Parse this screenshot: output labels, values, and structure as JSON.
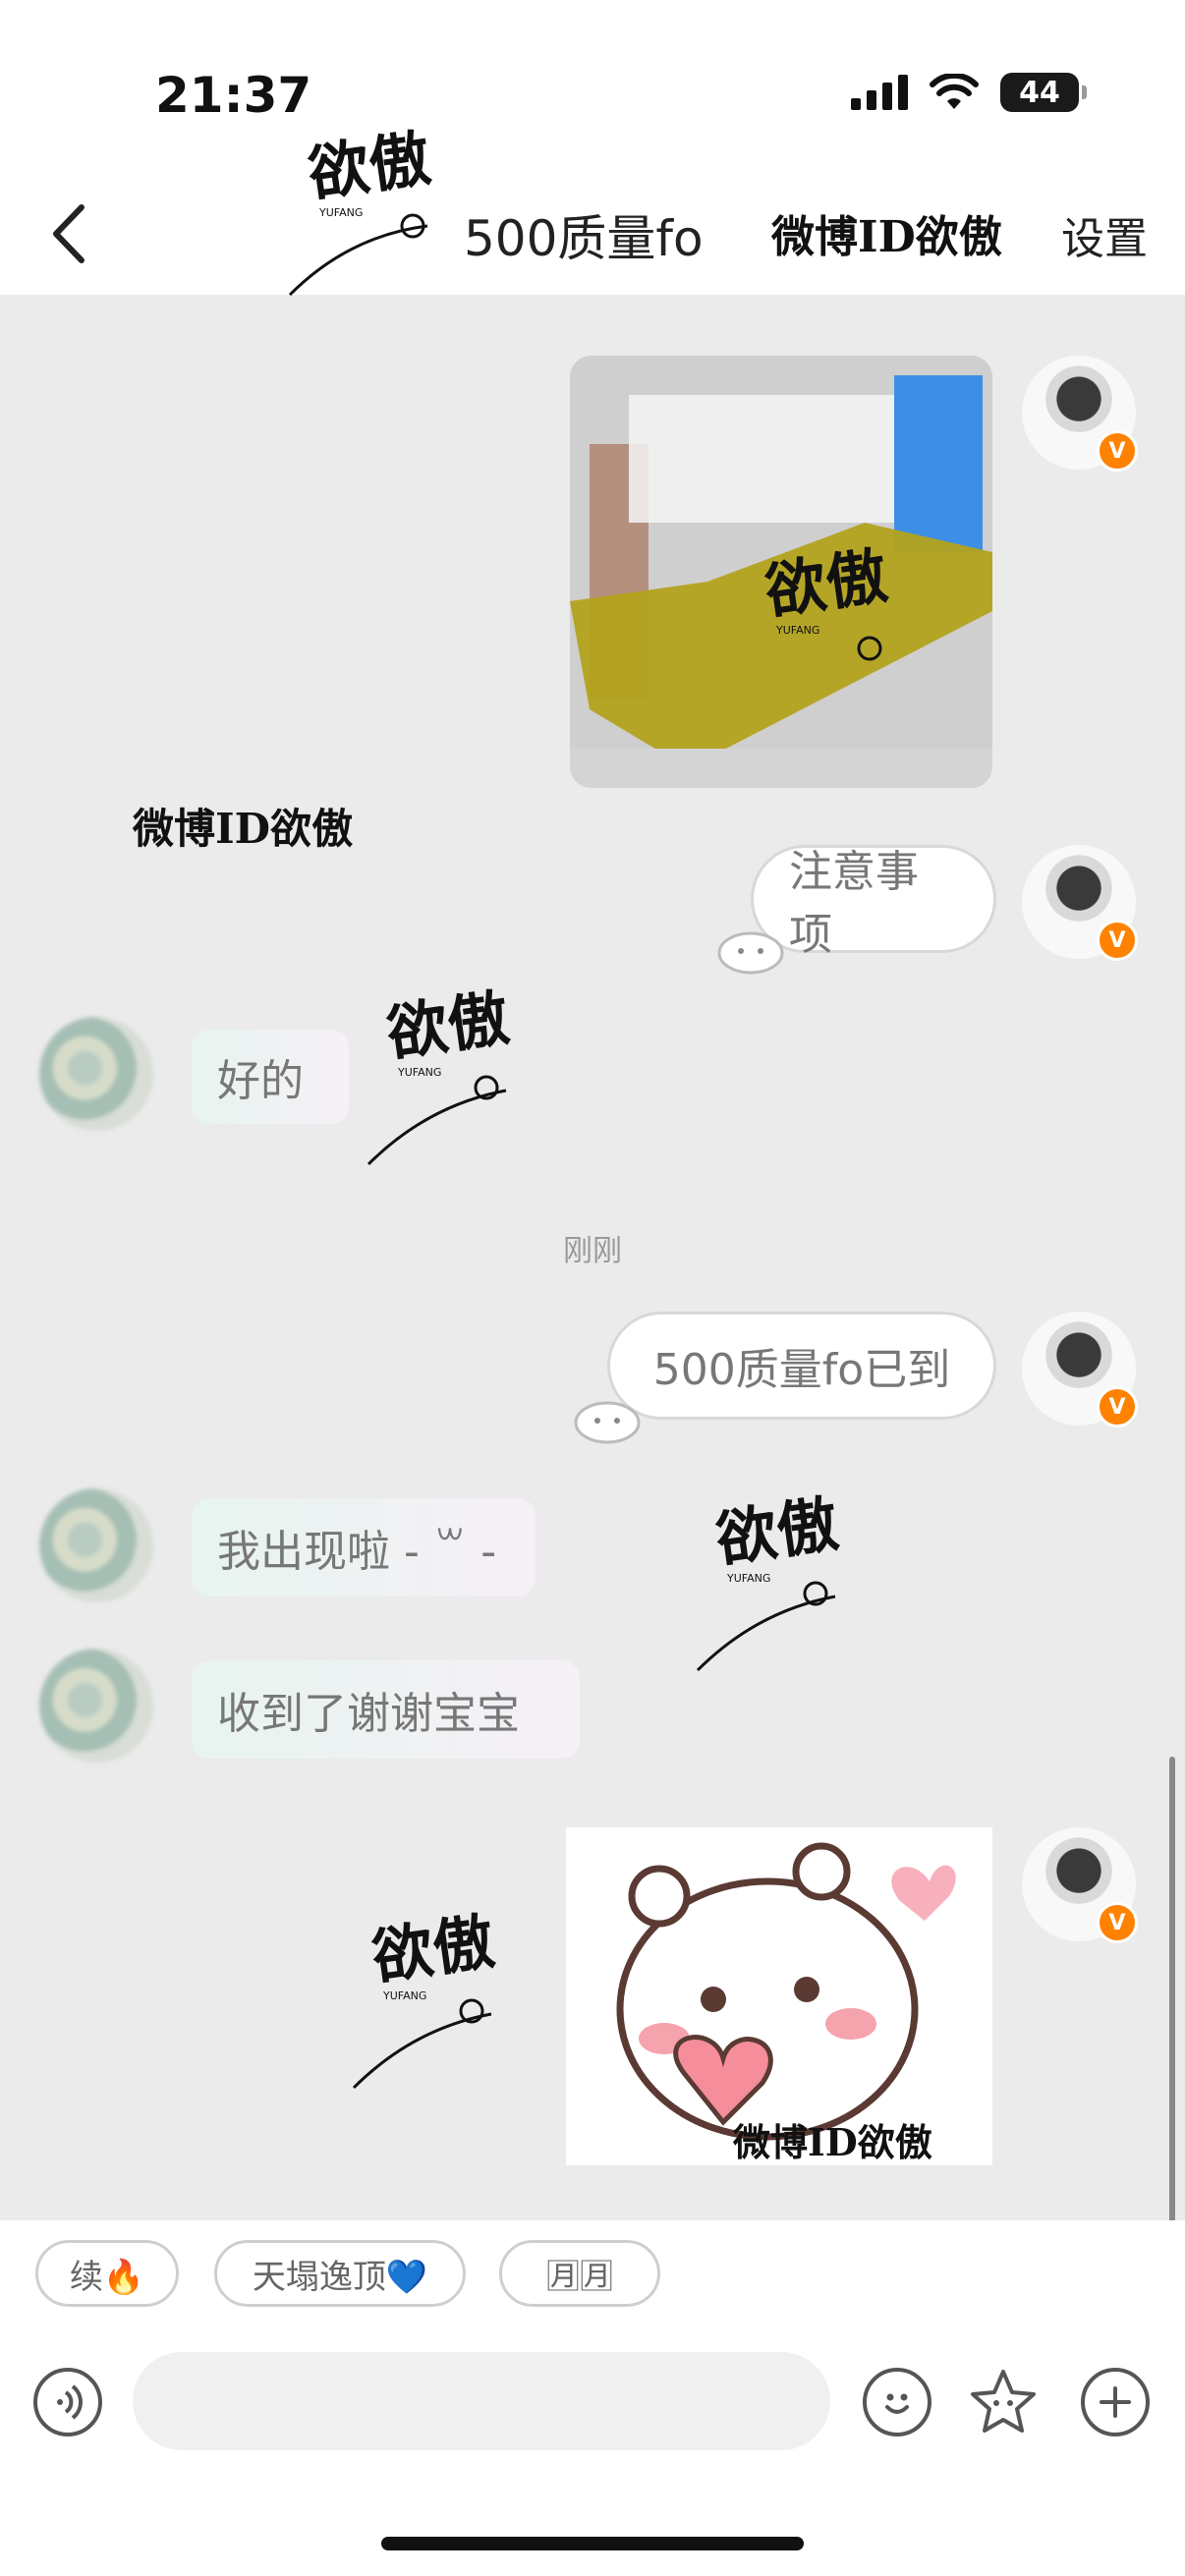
{
  "status_bar": {
    "time": "21:37",
    "battery": "44"
  },
  "header": {
    "title": "500质量fo",
    "handle": "微博ID欲傲",
    "settings_label": "设置"
  },
  "chat": {
    "messages": [
      {
        "from": "me",
        "kind": "image"
      },
      {
        "from": "me",
        "kind": "text",
        "text": "注意事项"
      },
      {
        "from": "other",
        "kind": "text",
        "text": "好的"
      },
      {
        "from": "me",
        "kind": "text",
        "text": "500质量fo已到"
      },
      {
        "from": "other",
        "kind": "text",
        "text": "我出现啦 - ꒳ -"
      },
      {
        "from": "other",
        "kind": "text",
        "text": "收到了谢谢宝宝"
      },
      {
        "from": "me",
        "kind": "sticker"
      }
    ],
    "time_divider": "刚刚",
    "watermark_text": "微博ID欲傲",
    "watermark_logo": {
      "main": "欲傲",
      "sub": "YUFANG"
    }
  },
  "quick_tags": [
    {
      "label": "续🔥"
    },
    {
      "label": "天塌逸顶💙"
    },
    {
      "label": "🈷🈷"
    }
  ],
  "input": {
    "placeholder": ""
  },
  "icons": {
    "back": "chevron-left-icon",
    "voice": "voice-icon",
    "emoji": "emoji-icon",
    "sticker": "star-sticker-icon",
    "more": "plus-icon"
  },
  "colors": {
    "verified_badge": "#ff8200",
    "chat_bg": "#ebebeb"
  }
}
